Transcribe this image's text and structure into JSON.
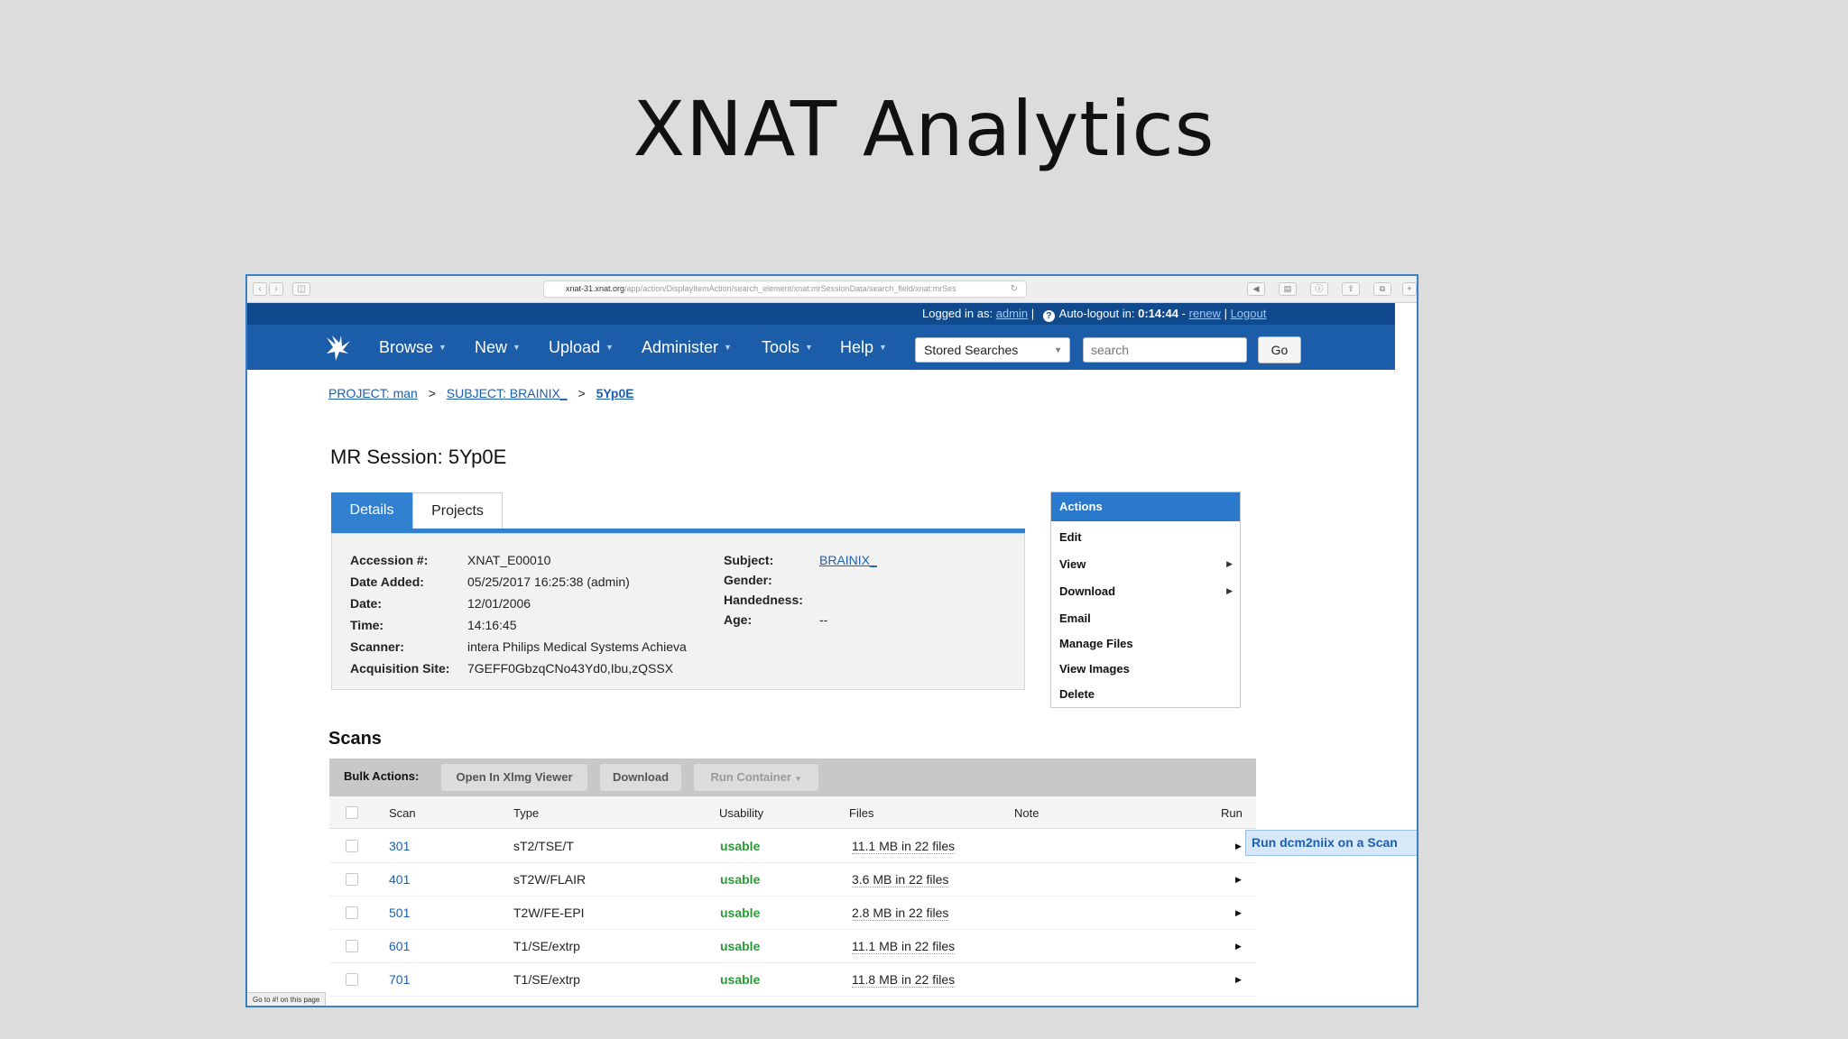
{
  "slide": {
    "title": "XNAT Analytics"
  },
  "browser": {
    "url_host": "xnat-31.xnat.org",
    "url_path": "/app/action/DisplayItemAction/search_element/xnat:mrSessionData/search_field/xnat:mrSes",
    "status_text": "Go to #! on this page"
  },
  "userbar": {
    "logged_in_label": "Logged in as:",
    "user": "admin",
    "autologout_label": "Auto-logout in:",
    "autologout_time": "0:14:44",
    "renew": "renew",
    "logout": "Logout"
  },
  "nav": {
    "items": [
      "Browse",
      "New",
      "Upload",
      "Administer",
      "Tools",
      "Help"
    ],
    "stored_searches": "Stored Searches",
    "search_placeholder": "search",
    "go": "Go"
  },
  "breadcrumb": {
    "project": "PROJECT: man",
    "subject": "SUBJECT: BRAINIX_",
    "current": "5Yp0E",
    "sep": ">"
  },
  "session": {
    "title": "MR Session: 5Yp0E",
    "tabs": [
      "Details",
      "Projects"
    ],
    "fields_left": [
      {
        "k": "Accession #:",
        "v": "XNAT_E00010"
      },
      {
        "k": "Date Added:",
        "v": "05/25/2017 16:25:38 (admin)"
      },
      {
        "k": "Date:",
        "v": "12/01/2006"
      },
      {
        "k": "Time:",
        "v": "14:16:45"
      },
      {
        "k": "Scanner:",
        "v": "intera Philips Medical Systems Achieva"
      },
      {
        "k": "Acquisition Site:",
        "v": "7GEFF0GbzqCNo43Yd0,Ibu,zQSSX"
      }
    ],
    "fields_right": [
      {
        "k": "Subject:",
        "v": "BRAINIX_"
      },
      {
        "k": "Gender:",
        "v": ""
      },
      {
        "k": "Handedness:",
        "v": ""
      },
      {
        "k": "Age:",
        "v": "--"
      }
    ]
  },
  "actions": {
    "header": "Actions",
    "items": [
      "Edit",
      "View",
      "Download",
      "Email",
      "Manage Files",
      "View Images",
      "Delete"
    ]
  },
  "scans": {
    "title": "Scans",
    "bulk_label": "Bulk Actions:",
    "bulk_buttons": [
      "Open In Xlmg Viewer",
      "Download",
      "Run Container"
    ],
    "headers": [
      "Scan",
      "Type",
      "Usability",
      "Files",
      "Note",
      "Run"
    ],
    "rows": [
      {
        "scan": "301",
        "type": "sT2/TSE/T",
        "usability": "usable",
        "files": "11.1 MB in 22 files"
      },
      {
        "scan": "401",
        "type": "sT2W/FLAIR",
        "usability": "usable",
        "files": "3.6 MB in 22 files"
      },
      {
        "scan": "501",
        "type": "T2W/FE-EPI",
        "usability": "usable",
        "files": "2.8 MB in 22 files"
      },
      {
        "scan": "601",
        "type": "T1/SE/extrp",
        "usability": "usable",
        "files": "11.1 MB in 22 files"
      },
      {
        "scan": "701",
        "type": "T1/SE/extrp",
        "usability": "usable",
        "files": "11.8 MB in 22 files"
      }
    ],
    "run_tooltip": "Run dcm2niix on a Scan"
  }
}
